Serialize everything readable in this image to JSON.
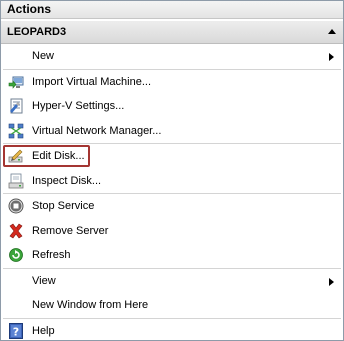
{
  "panel": {
    "title": "Actions"
  },
  "group": {
    "label": "LEOPARD3"
  },
  "items": [
    {
      "label": "New",
      "icon": "none",
      "submenu": true
    },
    {
      "label": "Import Virtual Machine...",
      "icon": "import-vm-icon",
      "submenu": false
    },
    {
      "label": "Hyper-V Settings...",
      "icon": "settings-icon",
      "submenu": false
    },
    {
      "label": "Virtual Network Manager...",
      "icon": "network-manager-icon",
      "submenu": false
    },
    {
      "label": "Edit Disk...",
      "icon": "edit-disk-icon",
      "submenu": false,
      "highlighted": true
    },
    {
      "label": "Inspect Disk...",
      "icon": "inspect-disk-icon",
      "submenu": false
    },
    {
      "label": "Stop Service",
      "icon": "stop-icon",
      "submenu": false
    },
    {
      "label": "Remove Server",
      "icon": "remove-x-icon",
      "submenu": false
    },
    {
      "label": "Refresh",
      "icon": "refresh-icon",
      "submenu": false
    },
    {
      "label": "View",
      "icon": "none",
      "submenu": true
    },
    {
      "label": "New Window from Here",
      "icon": "none",
      "submenu": false
    },
    {
      "label": "Help",
      "icon": "help-icon",
      "submenu": false
    }
  ],
  "colors": {
    "highlight_border": "#a43532",
    "header_bg": "#e4e4e4"
  }
}
